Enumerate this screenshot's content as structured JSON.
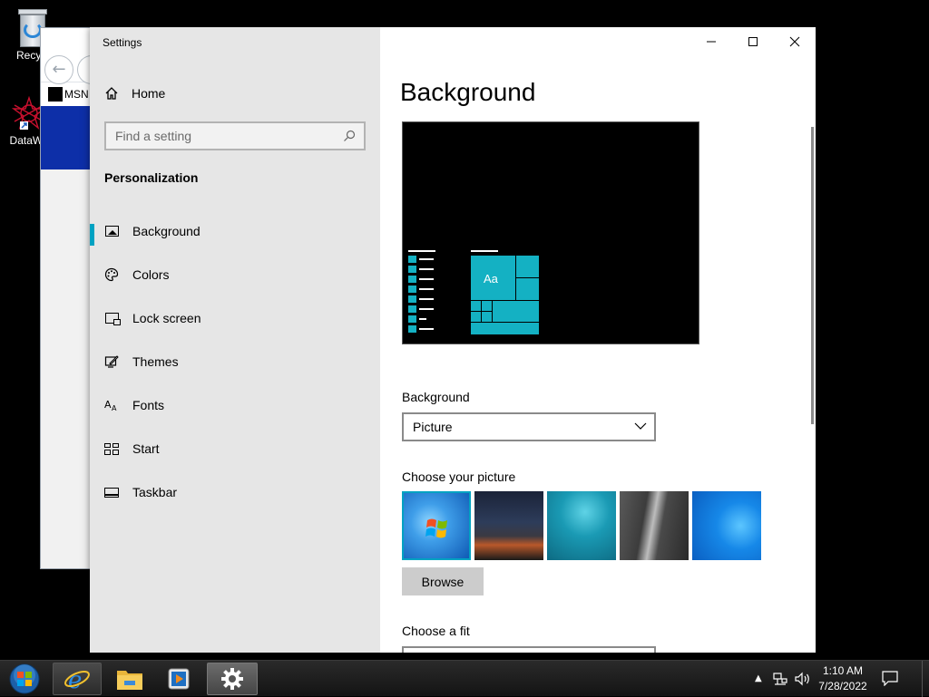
{
  "desktop": {
    "icons": [
      {
        "label": "Recycl"
      },
      {
        "label": "DataWa"
      }
    ]
  },
  "ie_window": {
    "tab_label": "MSN"
  },
  "settings": {
    "app_title": "Settings",
    "home_label": "Home",
    "search": {
      "placeholder": "Find a setting"
    },
    "section_title": "Personalization",
    "nav": [
      {
        "label": "Background",
        "icon": "picture-icon",
        "selected": true
      },
      {
        "label": "Colors",
        "icon": "palette-icon"
      },
      {
        "label": "Lock screen",
        "icon": "lock-screen-icon"
      },
      {
        "label": "Themes",
        "icon": "themes-icon"
      },
      {
        "label": "Fonts",
        "icon": "fonts-icon"
      },
      {
        "label": "Start",
        "icon": "start-icon"
      },
      {
        "label": "Taskbar",
        "icon": "taskbar-icon"
      }
    ],
    "page_title": "Background",
    "preview": {
      "tile_text": "Aa"
    },
    "background_label": "Background",
    "background_value": "Picture",
    "choose_picture_label": "Choose your picture",
    "browse_label": "Browse",
    "choose_fit_label": "Choose a fit",
    "accent_color": "#00a2c2"
  },
  "taskbar": {
    "time": "1:10 AM",
    "date": "7/28/2022"
  }
}
